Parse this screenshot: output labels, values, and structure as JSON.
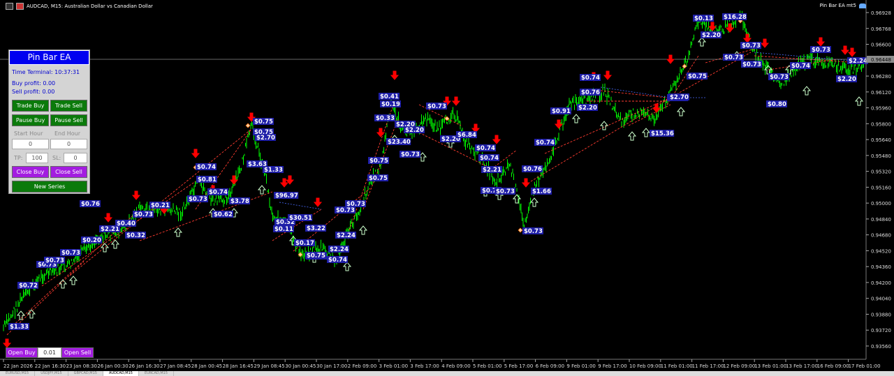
{
  "window": {
    "title": "AUDCAD, M15:  Australian Dollar vs Canadian Dollar",
    "ea_label": "Pin Bar EA mt5"
  },
  "colors": {
    "background": "#000000",
    "candle": "#00ff00",
    "bid_line": "#8c8c8c",
    "panel": "#d4d4d4",
    "panel_title": "#0000f0",
    "button_green": "#0b7a0b",
    "button_purple": "#a31de0",
    "buy_arrow": "#ccffcc",
    "sell_arrow": "#ff0000",
    "trade_line": "#ff3b2f",
    "profit_label": "#1f1fa8"
  },
  "panel": {
    "title": "Pin Bar EA",
    "time_terminal": "Time Terminal: 10:37:31",
    "buy_profit": "Buy profit: 0.00",
    "sell_profit": "Sell profit: 0.00",
    "trade_buy": "Trade Buy",
    "trade_sell": "Trade Sell",
    "pause_buy": "Pause Buy",
    "pause_sell": "Pause Sell",
    "start_hour_label": "Start Hour",
    "end_hour_label": "End Hour",
    "start_hour": "0",
    "end_hour": "0",
    "tp_label": "TP:",
    "tp_value": "100",
    "sl_label": "SL:",
    "sl_value": "0",
    "close_buy": "Close Buy",
    "close_sell": "Close Sell",
    "new_series": "New Series"
  },
  "bottom": {
    "open_buy": "Open Buy",
    "lot": "0.01",
    "open_sell": "Open Sell"
  },
  "price_axis": {
    "current": "0.96448",
    "ticks": [
      "0.96928",
      "0.96768",
      "0.96600",
      "0.96448",
      "0.96280",
      "0.96120",
      "0.95960",
      "0.95800",
      "0.95640",
      "0.95480",
      "0.95320",
      "0.95160",
      "0.95000",
      "0.94840",
      "0.94680",
      "0.94520",
      "0.94360",
      "0.94200",
      "0.94040",
      "0.93880",
      "0.93720",
      "0.93560"
    ]
  },
  "time_axis": [
    "22 Jan 2026",
    "22 Jan 16:30",
    "23 Jan 08:30",
    "26 Jan 00:30",
    "26 Jan 16:30",
    "27 Jan 08:45",
    "28 Jan 00:45",
    "28 Jan 16:45",
    "29 Jan 08:45",
    "30 Jan 00:45",
    "30 Jan 17:00",
    "2 Feb 09:00",
    "3 Feb 01:00",
    "3 Feb 17:00",
    "4 Feb 09:00",
    "5 Feb 01:00",
    "5 Feb 17:00",
    "6 Feb 09:00",
    "9 Feb 01:00",
    "9 Feb 17:00",
    "10 Feb 09:00",
    "11 Feb 01:00",
    "11 Feb 17:00",
    "12 Feb 09:00",
    "13 Feb 01:00",
    "13 Feb 17:00",
    "16 Feb 09:00",
    "17 Feb 01:00"
  ],
  "profit_labels": [
    "$0.72",
    "$1.33",
    "$0.73",
    "$0.73",
    "$0.73",
    "$0.20",
    "$0.76",
    "$2.21",
    "$0.40",
    "$0.73",
    "$0.32",
    "$0.21",
    "$0.74",
    "$0.81",
    "$0.73",
    "$0.74",
    "$3.78",
    "$0.62",
    "$0.75",
    "$0.75",
    "$2.70",
    "$3.63",
    "$1.33",
    "$96.97",
    "$0.32",
    "$0.11",
    "$30.51",
    "$3.22",
    "$0.17",
    "$0.75",
    "$0.75",
    "$2.24",
    "$0.74",
    "$2.24",
    "$0.73",
    "$0.73",
    "$0.75",
    "$0.75",
    "$0.33",
    "$0.41",
    "$0.19",
    "$2.20",
    "$23.40",
    "$0.73",
    "$0.73",
    "$2.20",
    "$2.20",
    "$6.84",
    "$0.74",
    "$0.74",
    "$2.21",
    "$0.74",
    "$0.73",
    "$0.76",
    "$1.66",
    "$0.73",
    "$0.74",
    "$0.91",
    "$0.74",
    "$0.76",
    "$2.20",
    "$15.36",
    "$0.75",
    "$2.70",
    "$0.75",
    "$0.13",
    "$2.20",
    "$16.28",
    "$0.73",
    "$0.73",
    "$0.73",
    "$0.80",
    "$0.73",
    "$0.74",
    "$0.73",
    "$2.24",
    "$2.20"
  ],
  "tabs": [
    "EURUSD,M15",
    "USDJPY,M15",
    "GBPCAD,M15",
    "AUDCAD,M15",
    "EURCAD,M15"
  ]
}
